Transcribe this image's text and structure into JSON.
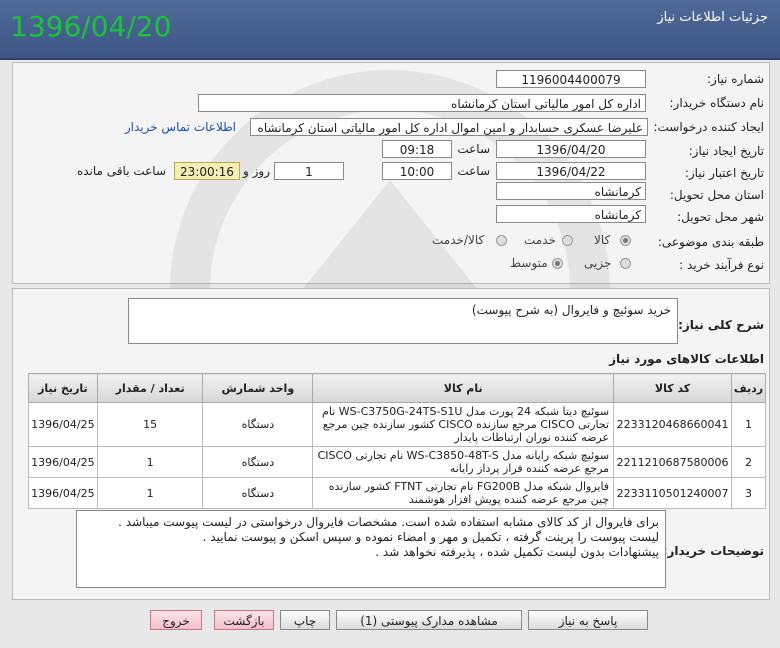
{
  "header": {
    "date": "1396/04/20",
    "title": "جزئیات اطلاعات نیاز"
  },
  "form": {
    "need_number_label": "شماره نیاز:",
    "need_number": "1196004400079",
    "buyer_label": "نام دستگاه خریدار:",
    "buyer": "اداره کل  امور مالیاتی استان کرمانشاه",
    "creator_label": "ایجاد کننده درخواست:",
    "creator": "علیرضا عسکری حسابدار و امین اموال اداره کل  امور مالیاتی استان کرمانشاه",
    "contact_link": "اطلاعات تماس خریدار",
    "created_date_label": "تاریخ ایجاد نیاز:",
    "created_date": "1396/04/20",
    "time_label": "ساعت",
    "created_time": "09:18",
    "validity_label": "تاریخ اعتبار نیاز:",
    "validity_date": "1396/04/22",
    "validity_time": "10:00",
    "days": "1",
    "days_label": "روز و",
    "remaining_time": "23:00:16",
    "remaining_label": "ساعت باقی مانده",
    "province_label": "استان محل تحویل:",
    "province": "کرمانشاه",
    "city_label": "شهر محل تحویل:",
    "city": "کرمانشاه",
    "category_label": "طبقه بندی موضوعی:",
    "category_options": [
      "کالا",
      "خدمت",
      "کالا/خدمت"
    ],
    "category_selected": "کالا",
    "process_label": "نوع فرآیند خرید :",
    "process_options": [
      "جزیی",
      "متوسط"
    ],
    "process_selected": "متوسط"
  },
  "summary": {
    "label": "شرح کلی نیاز:",
    "text": "خرید سوئیچ و فایروال (به شرح پیوست)"
  },
  "items": {
    "title": "اطلاعات کالاهای مورد نیاز",
    "columns": [
      "ردیف",
      "کد کالا",
      "نام کالا",
      "واحد شمارش",
      "تعداد / مقدار",
      "تاریخ نیاز"
    ],
    "rows": [
      {
        "row": "1",
        "code": "2233120468660041",
        "name": "سوئیچ دیتا شبکه 24 پورت مدل WS-C3750G-24TS-S1U نام تجارتی CISCO مرجع سازنده CISCO کشور سازنده چین مرجع عرضه کننده نوران ارتباطات پایدار",
        "unit": "دستگاه",
        "qty": "15",
        "date": "1396/04/25"
      },
      {
        "row": "2",
        "code": "2211210687580006",
        "name": "سوئیچ شبکه رایانه مدل WS-C3850-48T-S نام تجارتی CISCO مرجع عرضه کننده فراز پرداز رایانه",
        "unit": "دستگاه",
        "qty": "1",
        "date": "1396/04/25"
      },
      {
        "row": "3",
        "code": "2233110501240007",
        "name": "فایروال شبکه مدل FG200B نام تجارتی FTNT کشور سازنده چین مرجع عرضه کننده پویش افزار هوشمند",
        "unit": "دستگاه",
        "qty": "1",
        "date": "1396/04/25"
      }
    ]
  },
  "buyer_notes": {
    "label": "توضیحات خریدار:",
    "lines": [
      "برای فایروال از کد کالای مشابه استفاده شده است. مشخصات فایروال درخواستی در لیست پیوست میباشد .",
      "لیست پیوست را پرینت گرفته ، تکمیل و مهر و امضاء نموده و سپس اسکن و پیوست  نمایید .",
      "پیشنهادات بدون لیست تکمیل شده ، پذیرفته نخواهد شد ."
    ]
  },
  "buttons": {
    "reply": "پاسخ به نیاز",
    "attachments": "مشاهده مدارک پیوستی (1)",
    "print": "چاپ",
    "back": "بازگشت",
    "exit": "خروج"
  }
}
